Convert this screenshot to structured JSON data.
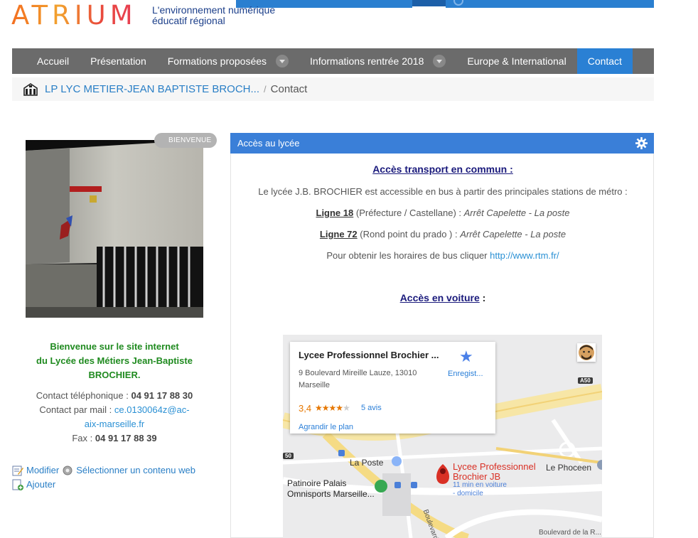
{
  "brand": {
    "logo_text": "ATRIUM",
    "tagline_line1": "L'environnement numérique",
    "tagline_line2": "éducatif régional"
  },
  "nav": {
    "items": [
      {
        "label": "Accueil"
      },
      {
        "label": "Présentation"
      },
      {
        "label": "Formations proposées"
      },
      {
        "label": "Informations rentrée 2018"
      },
      {
        "label": "Europe & International"
      },
      {
        "label": "Contact"
      }
    ]
  },
  "breadcrumb": {
    "home_label": "LP LYC METIER-JEAN BAPTISTE BROCH...",
    "separator": "/",
    "current": "Contact"
  },
  "sidebar": {
    "badge": "BIENVENUE",
    "welcome_line1": "Bienvenue sur le site internet",
    "welcome_line2": "du Lycée des Métiers Jean-Baptiste",
    "welcome_line3": "BROCHIER.",
    "phone_label": "Contact téléphonique :",
    "phone_value": "04 91 17 88 30",
    "mail_label": "Contact par mail :",
    "mail_value_1": "ce.0130064z@ac-",
    "mail_value_2": "aix-marseille.fr",
    "fax_label": "Fax :",
    "fax_value": "04 91 17 88 39",
    "edit_link": "Modifier",
    "select_link": "Sélectionner un contenu web",
    "add_link": "Ajouter"
  },
  "panel": {
    "title": "Accès au lycée",
    "transport_title": "Accès transport en commun :",
    "transport_intro": "Le lycée J.B. BROCHIER est accessible en bus à partir des principales stations de métro :",
    "line18_label": "Ligne 18",
    "line18_route": "(Préfecture / Castellane) :",
    "line18_stop": "Arrêt Capelette - La poste",
    "line72_label": "Ligne 72",
    "line72_route": "(Rond point du prado ) :",
    "line72_stop": "Arrêt Capelette - La poste",
    "schedule_text": "Pour obtenir les horaires de bus cliquer",
    "schedule_link": "http://www.rtm.fr/",
    "car_title": "Accès en voiture",
    "car_suffix": ":"
  },
  "map": {
    "place_name": "Lycee Professionnel Brochier ...",
    "address_line1": "9 Boulevard Mireille Lauze, 13010",
    "address_line2": "Marseille",
    "save_label": "Enregist...",
    "rating": "3,4",
    "rating_value": 3.4,
    "reviews": "5 avis",
    "enlarge": "Agrandir le plan",
    "label_laposte": "La Poste",
    "label_patinoire_1": "Patinoire Palais",
    "label_patinoire_2": "Omnisports Marseille...",
    "label_pin_1": "Lycee Professionnel",
    "label_pin_2": "Brochier JB",
    "label_drive_1": "11 min en voiture",
    "label_drive_2": "- domicile",
    "label_phoceen": "Le Phoceen",
    "label_boulevard": "Boulevard de la R...",
    "label_boulevard2": "Boulevard",
    "shield_a50": "A50",
    "shield_50": "50"
  },
  "colors": {
    "nav_bg": "#6b6b6b",
    "nav_active": "#2a80d4",
    "panel_header": "#3a7fd8",
    "welcome_green": "#1f8a1f",
    "link_blue": "#2a7fc6",
    "title_navy": "#1a1a7c"
  }
}
